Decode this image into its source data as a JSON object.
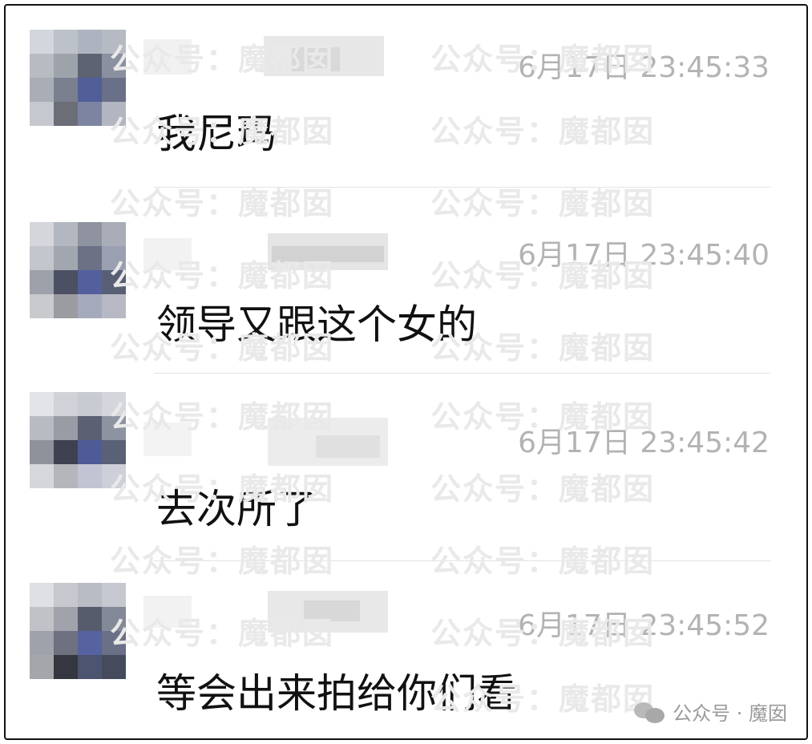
{
  "watermark": "公众号：魔都囡",
  "credit": {
    "text": "公众号 · 魔囡",
    "icon": "wechat-icon"
  },
  "messages": [
    {
      "time": "6月17日 23:45:33",
      "text": "我尼玛"
    },
    {
      "time": "6月17日 23:45:40",
      "text": "领导又跟这个女的"
    },
    {
      "time": "6月17日 23:45:42",
      "text": "去次所了"
    },
    {
      "time": "6月17日 23:45:52",
      "text": "等会出来拍给你们看"
    }
  ]
}
